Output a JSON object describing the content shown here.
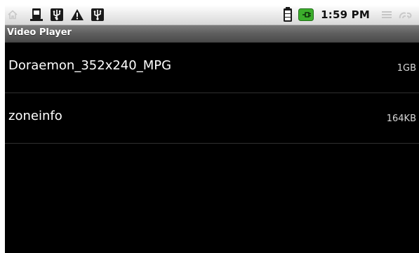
{
  "status_bar": {
    "left_icons": [
      "home-icon",
      "sd-card-icon",
      "usb-icon",
      "warning-icon",
      "usb-debug-icon"
    ],
    "right_icons": [
      "battery-icon",
      "charging-plug-icon",
      "menu-icon",
      "signal-icon"
    ],
    "time": "1:59 PM"
  },
  "title_bar": {
    "title": "Video Player"
  },
  "file_list": {
    "items": [
      {
        "name": "Doraemon_352x240_MPG",
        "size": "1GB"
      },
      {
        "name": "zoneinfo",
        "size": "164KB"
      }
    ]
  },
  "colors": {
    "background": "#000000",
    "title_bar": "#5e5e5e",
    "status_bar": "#e9e9e9",
    "accent_green": "#3cae2c",
    "divider": "#2f2f2f"
  }
}
